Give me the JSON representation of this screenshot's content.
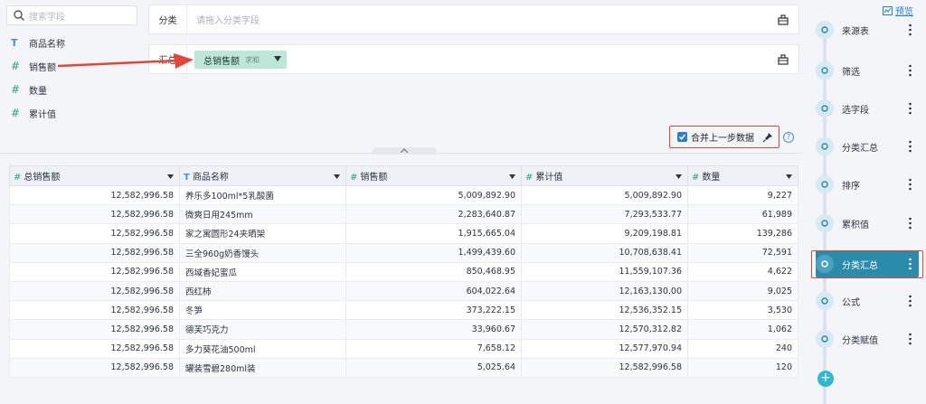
{
  "fields": {
    "search_placeholder": "搜索字段",
    "items": [
      {
        "type": "T",
        "label": "商品名称"
      },
      {
        "type": "#",
        "label": "销售额"
      },
      {
        "type": "#",
        "label": "数量"
      },
      {
        "type": "#",
        "label": "累计值"
      }
    ]
  },
  "zones": {
    "category": {
      "label": "分类",
      "placeholder": "请拖入分类字段"
    },
    "summary": {
      "label": "汇总",
      "chip_label": "总销售额",
      "chip_agg": "求和"
    }
  },
  "merge": {
    "label": "合并上一步数据",
    "checked": true,
    "help": "?"
  },
  "table": {
    "headers": [
      {
        "type": "#",
        "label": "总销售额"
      },
      {
        "type": "T",
        "label": "商品名称"
      },
      {
        "type": "#",
        "label": "销售额"
      },
      {
        "type": "#",
        "label": "累计值"
      },
      {
        "type": "#",
        "label": "数量"
      }
    ],
    "rows": [
      [
        "12,582,996.58",
        "养乐多100ml*5乳酸菌",
        "5,009,892.90",
        "5,009,892.90",
        "9,227"
      ],
      [
        "12,582,996.58",
        "微爽日用245mm",
        "2,283,640.87",
        "7,293,533.77",
        "61,989"
      ],
      [
        "12,582,996.58",
        "家之寓圆形24夹晒架",
        "1,915,665.04",
        "9,209,198.81",
        "139,286"
      ],
      [
        "12,582,996.58",
        "三全960g奶香馒头",
        "1,499,439.60",
        "10,708,638.41",
        "72,591"
      ],
      [
        "12,582,996.58",
        "西域香妃蜜瓜",
        "850,468.95",
        "11,559,107.36",
        "4,622"
      ],
      [
        "12,582,996.58",
        "西红柿",
        "604,022.64",
        "12,163,130.00",
        "9,025"
      ],
      [
        "12,582,996.58",
        "冬笋",
        "373,222.15",
        "12,536,352.15",
        "3,530"
      ],
      [
        "12,582,996.58",
        "德芙巧克力",
        "33,960.67",
        "12,570,312.82",
        "1,062"
      ],
      [
        "12,582,996.58",
        "多力葵花油500ml",
        "7,658.12",
        "12,577,970.94",
        "240"
      ],
      [
        "12,582,996.58",
        "罐装雪碧280ml装",
        "5,025.64",
        "12,582,996.58",
        "120"
      ]
    ]
  },
  "right_panel": {
    "preview_label": "预览",
    "steps": [
      {
        "label": "来源表",
        "icon": "source-icon",
        "active": false
      },
      {
        "label": "筛选",
        "icon": "filter-icon",
        "active": false
      },
      {
        "label": "选字段",
        "icon": "select-fields-icon",
        "active": false
      },
      {
        "label": "分类汇总",
        "icon": "group-summary-icon",
        "active": false
      },
      {
        "label": "排序",
        "icon": "sort-icon",
        "active": false
      },
      {
        "label": "累积值",
        "icon": "cumulative-icon",
        "active": false
      },
      {
        "label": "分类汇总",
        "icon": "group-summary-icon",
        "active": true
      },
      {
        "label": "公式",
        "icon": "formula-icon",
        "active": false
      },
      {
        "label": "分类赋值",
        "icon": "assign-icon",
        "active": false
      }
    ],
    "add_label": "+"
  },
  "colors": {
    "accent": "#2a8bab",
    "highlight": "#e0473a",
    "chip": "#bde7d8",
    "checkbox": "#2a7fcf"
  }
}
